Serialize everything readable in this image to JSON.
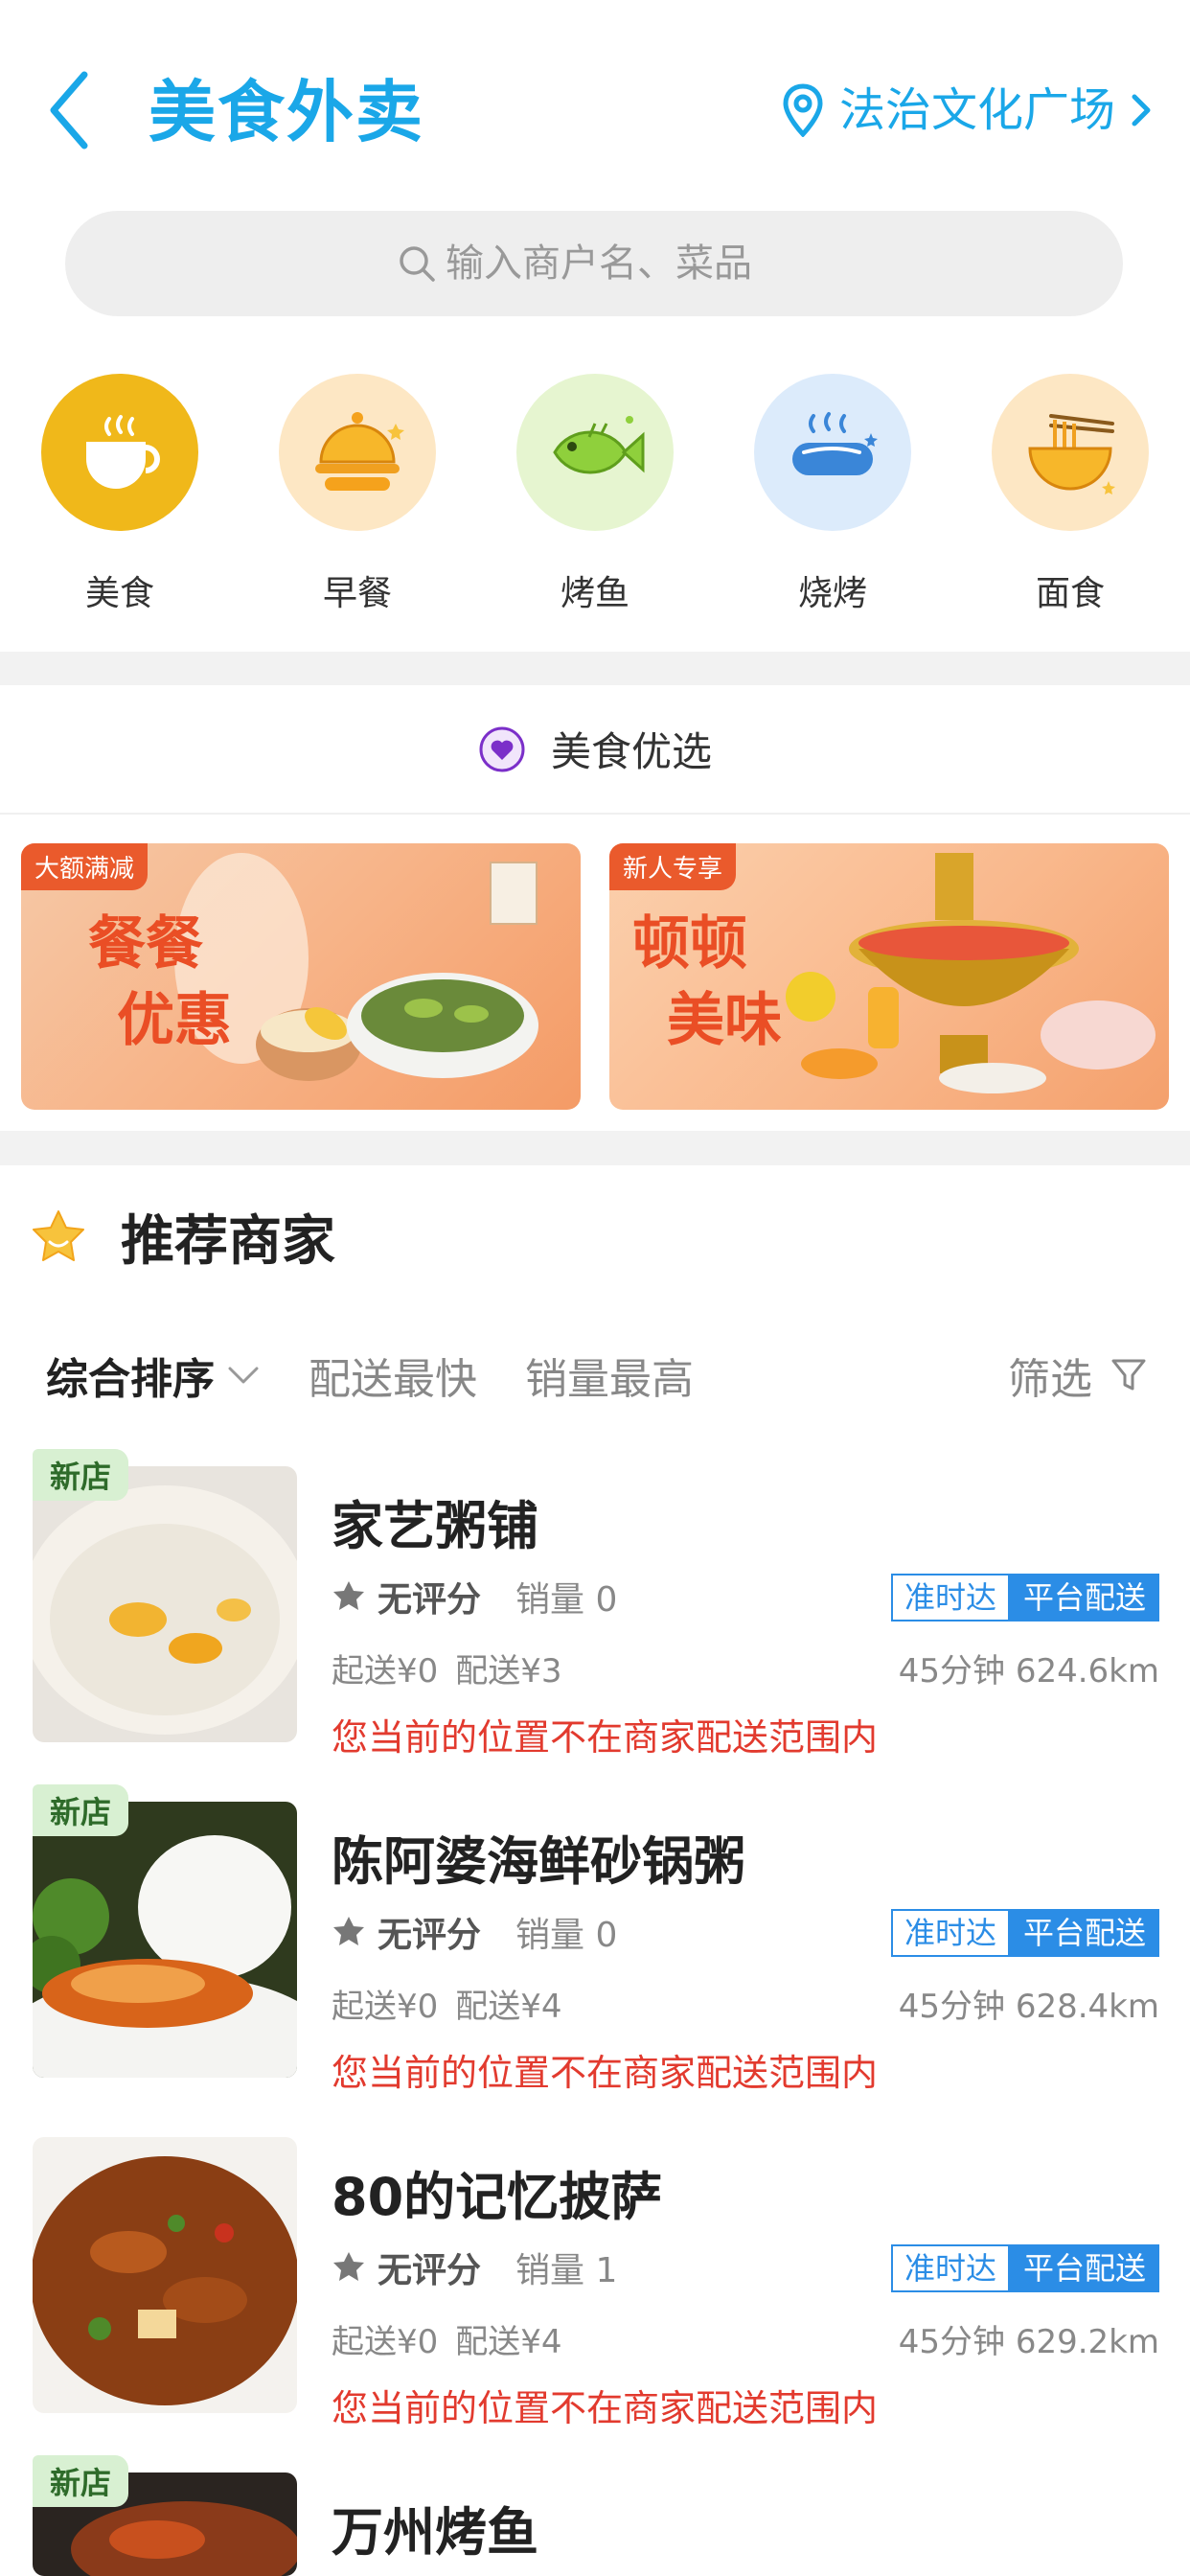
{
  "header": {
    "title": "美食外卖",
    "location": "法治文化广场",
    "icons": {
      "back": "back-chevron-icon",
      "location": "location-pin-icon",
      "forward": "chevron-right-icon"
    }
  },
  "search": {
    "placeholder": "输入商户名、菜品",
    "icon": "search-icon"
  },
  "categories": [
    {
      "label": "美食",
      "icon": "coffee-cup-icon"
    },
    {
      "label": "早餐",
      "icon": "food-cloche-icon"
    },
    {
      "label": "烤鱼",
      "icon": "fish-icon"
    },
    {
      "label": "烧烤",
      "icon": "sausage-icon"
    },
    {
      "label": "面食",
      "icon": "noodle-bowl-icon"
    }
  ],
  "selected": {
    "title": "美食优选",
    "icon": "heart-icon"
  },
  "banners": [
    {
      "tag": "大额满减",
      "line1": "餐餐",
      "line2": "优惠"
    },
    {
      "tag": "新人专享",
      "line1": "顿顿",
      "line2": "美味"
    }
  ],
  "recommend": {
    "title": "推荐商家",
    "icon": "star-icon"
  },
  "sort": {
    "comprehensive": "综合排序",
    "fastest": "配送最快",
    "top_sales": "销量最高",
    "filter": "筛选"
  },
  "merchants": [
    {
      "new_tag": "新店",
      "name": "家艺粥铺",
      "rating": "无评分",
      "sales": "销量 0",
      "badge_ontime": "准时达",
      "badge_platform": "平台配送",
      "min_order": "起送¥0",
      "delivery_fee": "配送¥3",
      "time_distance": "45分钟 624.6km",
      "warning": "您当前的位置不在商家配送范围内"
    },
    {
      "new_tag": "新店",
      "name": "陈阿婆海鲜砂锅粥",
      "rating": "无评分",
      "sales": "销量 0",
      "badge_ontime": "准时达",
      "badge_platform": "平台配送",
      "min_order": "起送¥0",
      "delivery_fee": "配送¥4",
      "time_distance": "45分钟 628.4km",
      "warning": "您当前的位置不在商家配送范围内"
    },
    {
      "new_tag": "",
      "name": "80的记忆披萨",
      "rating": "无评分",
      "sales": "销量 1",
      "badge_ontime": "准时达",
      "badge_platform": "平台配送",
      "min_order": "起送¥0",
      "delivery_fee": "配送¥4",
      "time_distance": "45分钟 629.2km",
      "warning": "您当前的位置不在商家配送范围内"
    },
    {
      "new_tag": "新店",
      "name": "万州烤鱼"
    }
  ],
  "colors": {
    "accent": "#1aa7e8",
    "warning": "#e23a2e",
    "badge": "#2b8de6"
  }
}
